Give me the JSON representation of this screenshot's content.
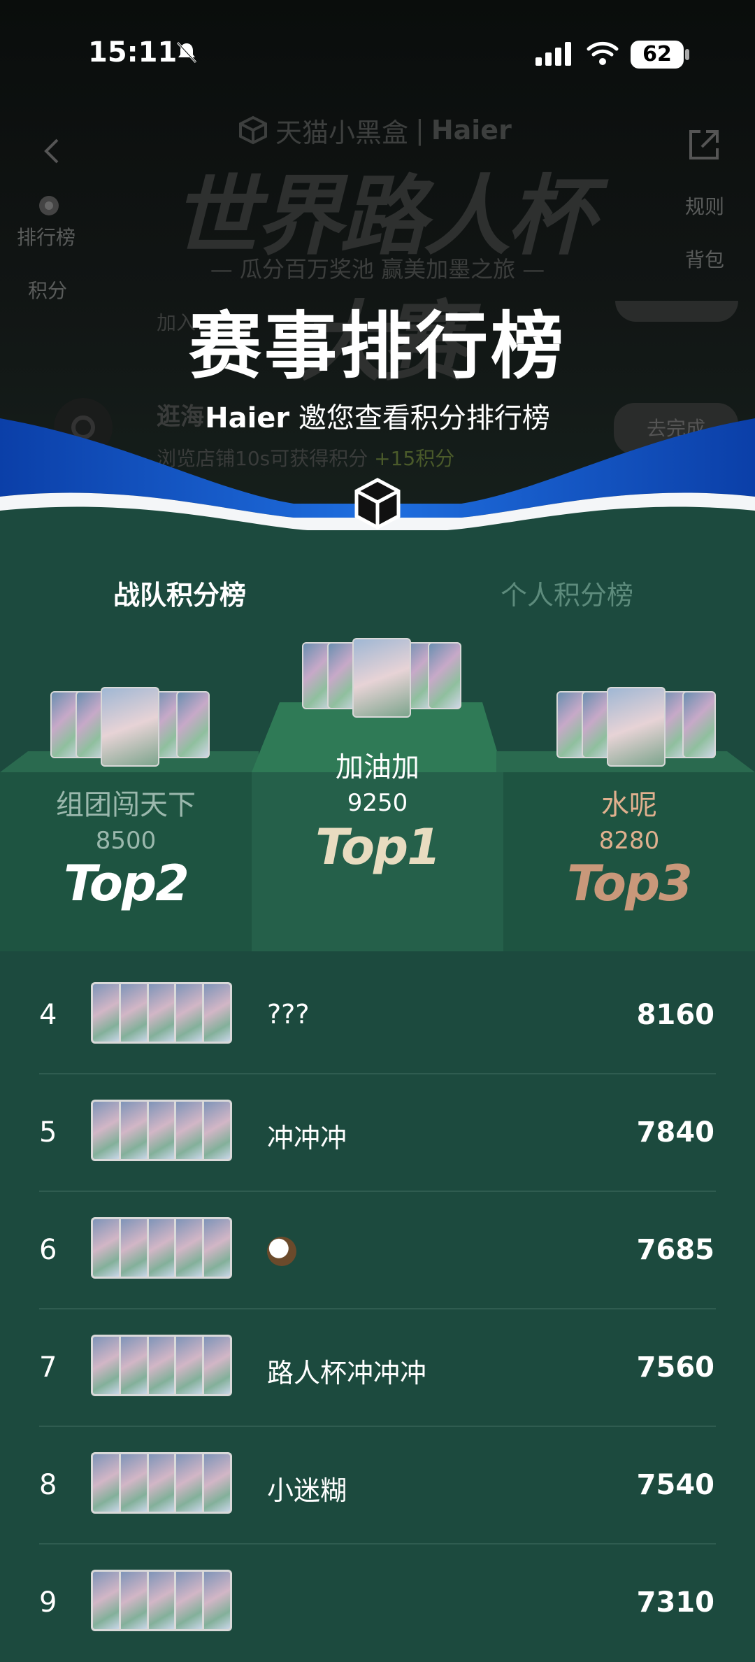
{
  "status_bar": {
    "time": "15:11",
    "battery": "62"
  },
  "header": {
    "brand_tmall": "天猫小黑盒",
    "brand_haier": "Haier",
    "event_title": "世界路人杯大赛",
    "tagline": "— 瓜分百万奖池 赢美加墨之旅 —",
    "side_left": [
      "排行榜",
      "积分"
    ],
    "side_right": [
      "规则",
      "背包"
    ],
    "ghost_task_1": "加入",
    "ghost_task_2": "逛海",
    "ghost_task_desc": "浏览店铺10s可获得积分",
    "ghost_task_reward": "+15积分",
    "ghost_button": "去完成",
    "main_title": "赛事排行榜",
    "subtitle_brand": "Haier",
    "subtitle_text": "邀您查看积分排行榜"
  },
  "tabs": [
    {
      "label": "战队积分榜",
      "active": true
    },
    {
      "label": "个人积分榜",
      "active": false
    }
  ],
  "podium": {
    "first": {
      "name": "加油加",
      "score": "9250",
      "label": "Top1"
    },
    "second": {
      "name": "组团闯天下",
      "score": "8500",
      "label": "Top2"
    },
    "third": {
      "name": "水呢",
      "score": "8280",
      "label": "Top3"
    }
  },
  "ranking": [
    {
      "rank": "4",
      "name": "???",
      "score": "8160"
    },
    {
      "rank": "5",
      "name": "冲冲冲",
      "score": "7840"
    },
    {
      "rank": "6",
      "name": "",
      "score": "7685",
      "icon": "coconut-icon"
    },
    {
      "rank": "7",
      "name": "路人杯冲冲冲",
      "score": "7560"
    },
    {
      "rank": "8",
      "name": "小迷糊",
      "score": "7540"
    },
    {
      "rank": "9",
      "name": "",
      "score": "7310"
    }
  ],
  "colors": {
    "background": "#1c4a3e",
    "podium": "#2a6a4f",
    "top1": "#e8dcc0",
    "top3": "#c9987a",
    "third_name": "#e0b08e"
  }
}
